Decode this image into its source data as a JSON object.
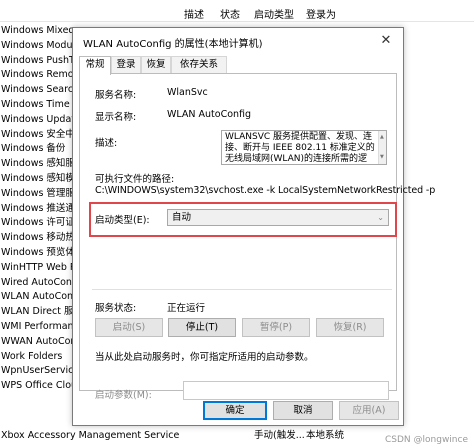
{
  "background": {
    "header": {
      "col_description": "描述",
      "col_status": "状态",
      "col_startup_type": "启动类型",
      "col_logon_as": "登录为"
    },
    "services": [
      "Windows Mixed Re",
      "Windows Modules",
      "Windows PushToIn",
      "Windows Remote M",
      "Windows Search",
      "Windows Time",
      "Windows Update",
      "Windows 安全中心",
      "Windows 备份",
      "Windows 感知服务",
      "Windows 感知模拟",
      "Windows 管理服务",
      "Windows 推送通知",
      "Windows 许可证管",
      "Windows 移动热点",
      "Windows 预览体验",
      "WinHTTP Web Pro",
      "Wired AutoConfig",
      "WLAN AutoConfig",
      "WLAN Direct 服务",
      "WMI Performance",
      "WWAN AutoConfig",
      "Work Folders",
      "WpnUserService_9",
      "WPS Office Cloud S"
    ],
    "bottom_row": {
      "name": "Xbox Accessory Management Service",
      "startup": "手动(触发...",
      "logon": "本地系统"
    },
    "watermark": "CSDN @longwince"
  },
  "dialog": {
    "title": "WLAN AutoConfig 的属性(本地计算机)",
    "close_glyph": "✕",
    "tabs": [
      "常规",
      "登录",
      "恢复",
      "依存关系"
    ],
    "active_tab": "常规",
    "fields": {
      "service_name_label": "服务名称:",
      "service_name_value": "WlanSvc",
      "display_name_label": "显示名称:",
      "display_name_value": "WLAN AutoConfig",
      "description_label": "描述:",
      "description_value": "WLANSVC 服务提供配置、发现、连接、断开与 IEEE 802.11 标准定义的无线局域网(WLAN)的连接所需的逻辑。它还包含将计算机或变为软件访问点的逻辑，以便",
      "path_label": "可执行文件的路径:",
      "path_value": "C:\\WINDOWS\\system32\\svchost.exe -k LocalSystemNetworkRestricted -p",
      "startup_type_label": "启动类型(E):",
      "startup_type_value": "自动",
      "service_status_label": "服务状态:",
      "service_status_value": "正在运行",
      "hint": "当从此处启动服务时，你可指定所适用的启动参数。",
      "start_params_label": "启动参数(M):",
      "start_params_value": ""
    },
    "buttons": {
      "start": "启动(S)",
      "stop": "停止(T)",
      "pause": "暂停(P)",
      "resume": "恢复(R)",
      "ok": "确定",
      "cancel": "取消",
      "apply": "应用(A)"
    },
    "highlight_color": "#e0474c",
    "accent_color": "#0078d7"
  }
}
